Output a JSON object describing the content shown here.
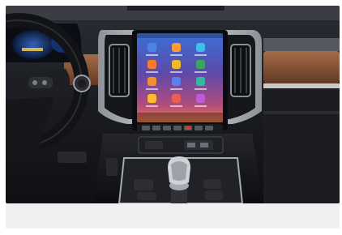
{
  "photo": {
    "subject": "car-interior-dashboard",
    "colors": {
      "dash_dark": "#1a1c22",
      "trim_silver": "#b7bac0",
      "wood_trim": "#8d5a3c",
      "screen_glow": "#6b4ca9"
    }
  },
  "screen": {
    "status_time": "",
    "apps": [
      {
        "label": "",
        "color": "#4e83e6",
        "icon": "app-icon"
      },
      {
        "label": "",
        "color": "#ff9c34",
        "icon": "app-icon"
      },
      {
        "label": "",
        "color": "#3cc0e8",
        "icon": "app-icon"
      },
      {
        "label": "",
        "color": "#ff7a2f",
        "icon": "app-icon"
      },
      {
        "label": "",
        "color": "#f3b72b",
        "icon": "app-icon"
      },
      {
        "label": "",
        "color": "#3aa85a",
        "icon": "app-icon"
      },
      {
        "label": "",
        "color": "#f1902f",
        "icon": "app-icon"
      },
      {
        "label": "",
        "color": "#5b7ef0",
        "icon": "app-icon"
      },
      {
        "label": "",
        "color": "#32b9a1",
        "icon": "app-icon"
      },
      {
        "label": "",
        "color": "#ffb92e",
        "icon": "app-icon"
      },
      {
        "label": "",
        "color": "#e85f55",
        "icon": "app-icon"
      },
      {
        "label": "",
        "color": "#c05ad8",
        "icon": "app-icon"
      }
    ]
  }
}
